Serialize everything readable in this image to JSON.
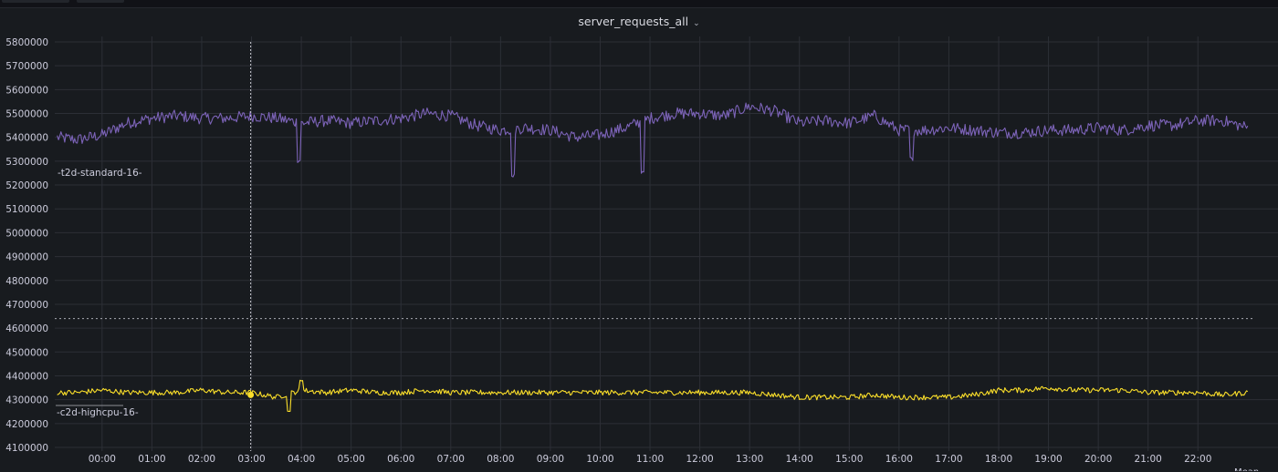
{
  "panel": {
    "title": "server_requests_all",
    "title_chevron": "⌄"
  },
  "chart_data": {
    "type": "line",
    "title": "server_requests_all",
    "xlabel": "",
    "ylabel": "",
    "ylim": [
      4100000,
      5800000
    ],
    "y_ticks": [
      "5800000",
      "5700000",
      "5600000",
      "5500000",
      "5400000",
      "5300000",
      "5200000",
      "5100000",
      "5000000",
      "4900000",
      "4800000",
      "4700000",
      "4600000",
      "4500000",
      "4400000",
      "4300000",
      "4200000",
      "4100000"
    ],
    "x_ticks": [
      "00:00",
      "01:00",
      "02:00",
      "03:00",
      "04:00",
      "05:00",
      "06:00",
      "07:00",
      "08:00",
      "09:00",
      "10:00",
      "11:00",
      "12:00",
      "13:00",
      "14:00",
      "15:00",
      "16:00",
      "17:00",
      "18:00",
      "19:00",
      "20:00",
      "21:00",
      "22:00"
    ],
    "x_range_hours": [
      -0.95,
      23.15
    ],
    "grid": true,
    "threshold_line": {
      "value": 4640000,
      "style": "dotted"
    },
    "crosshair": {
      "time": "02:59",
      "value": 4320000
    },
    "legend": {
      "visible_text": "Mean",
      "placement": "bottom-right"
    },
    "series": [
      {
        "name": "-t2d-standard-16-",
        "color": "#7c63b8",
        "x_hours": [
          -0.9,
          -0.5,
          0,
          0.5,
          1,
          1.5,
          2,
          2.5,
          3,
          3.5,
          4,
          4.5,
          5,
          5.5,
          6,
          6.5,
          7,
          7.5,
          8,
          8.5,
          9,
          9.5,
          10,
          10.5,
          11,
          11.5,
          12,
          12.5,
          13,
          13.5,
          14,
          14.5,
          15,
          15.5,
          16,
          16.5,
          17,
          17.5,
          18,
          18.5,
          19,
          19.5,
          20,
          20.5,
          21,
          21.5,
          22,
          22.5,
          23
        ],
        "values": [
          5400000,
          5390000,
          5410000,
          5460000,
          5480000,
          5490000,
          5480000,
          5480000,
          5490000,
          5480000,
          5460000,
          5470000,
          5460000,
          5470000,
          5480000,
          5500000,
          5490000,
          5450000,
          5430000,
          5440000,
          5430000,
          5400000,
          5410000,
          5440000,
          5480000,
          5500000,
          5500000,
          5490000,
          5530000,
          5510000,
          5460000,
          5470000,
          5460000,
          5490000,
          5430000,
          5430000,
          5440000,
          5430000,
          5420000,
          5420000,
          5430000,
          5430000,
          5440000,
          5430000,
          5450000,
          5450000,
          5470000,
          5470000,
          5440000
        ],
        "spikes": [
          {
            "x_hours": 3.95,
            "value": 5300000
          },
          {
            "x_hours": 8.25,
            "value": 5240000
          },
          {
            "x_hours": 10.85,
            "value": 5250000
          },
          {
            "x_hours": 16.25,
            "value": 5310000
          }
        ]
      },
      {
        "name": "-c2d-highcpu-16-",
        "color": "#fade2a",
        "x_hours": [
          -0.9,
          -0.5,
          0,
          0.5,
          1,
          1.5,
          2,
          2.5,
          3,
          3.5,
          4,
          4.5,
          5,
          5.5,
          6,
          6.5,
          7,
          7.5,
          8,
          8.5,
          9,
          9.5,
          10,
          10.5,
          11,
          11.5,
          12,
          12.5,
          13,
          13.5,
          14,
          14.5,
          15,
          15.5,
          16,
          16.5,
          17,
          17.5,
          18,
          18.5,
          19,
          19.5,
          20,
          20.5,
          21,
          21.5,
          22,
          22.5,
          23
        ],
        "values": [
          4330000,
          4330000,
          4340000,
          4330000,
          4330000,
          4330000,
          4340000,
          4330000,
          4330000,
          4310000,
          4340000,
          4330000,
          4340000,
          4330000,
          4330000,
          4340000,
          4330000,
          4330000,
          4330000,
          4330000,
          4330000,
          4330000,
          4330000,
          4330000,
          4330000,
          4330000,
          4330000,
          4330000,
          4330000,
          4320000,
          4310000,
          4310000,
          4310000,
          4320000,
          4310000,
          4310000,
          4310000,
          4320000,
          4340000,
          4340000,
          4350000,
          4340000,
          4340000,
          4340000,
          4330000,
          4330000,
          4330000,
          4320000,
          4330000
        ],
        "spikes": [
          {
            "x_hours": 3.75,
            "value": 4250000
          },
          {
            "x_hours": 4.0,
            "value": 4380000
          }
        ]
      }
    ]
  }
}
